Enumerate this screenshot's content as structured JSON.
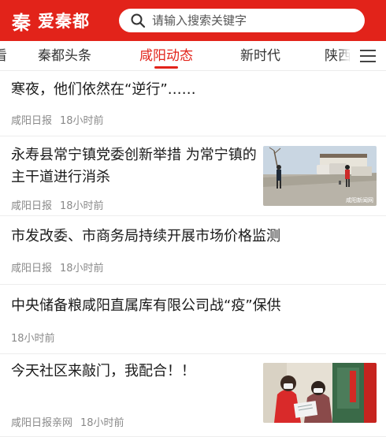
{
  "header": {
    "logo_mark": "秦",
    "app_name": "爱秦都",
    "search_placeholder": "请输入搜索关键字",
    "brand_color": "#e2231a"
  },
  "tabs": [
    {
      "label": "看"
    },
    {
      "label": "秦都头条"
    },
    {
      "label": "咸阳动态",
      "active": true
    },
    {
      "label": "新时代"
    },
    {
      "label": "陕西"
    }
  ],
  "menu_icon": "menu-icon",
  "news": [
    {
      "title": "寒夜，他们依然在“逆行”……",
      "source": "咸阳日报",
      "time": "18小时前"
    },
    {
      "title": "永寿县常宁镇党委创新举措 为常宁镇的主干道进行消杀",
      "source": "咸阳日报",
      "time": "18小时前",
      "thumb_caption": "咸阳新闻网"
    },
    {
      "title": "市发改委、市商务局持续开展市场价格监测",
      "source": "咸阳日报",
      "time": "18小时前"
    },
    {
      "title": "中央储备粮咸阳直属库有限公司战“疫”保供",
      "source": "",
      "time": "18小时前"
    },
    {
      "title": "今天社区来敲门，我配合！！",
      "source": "咸阳日报亲网",
      "time": "18小时前"
    }
  ]
}
